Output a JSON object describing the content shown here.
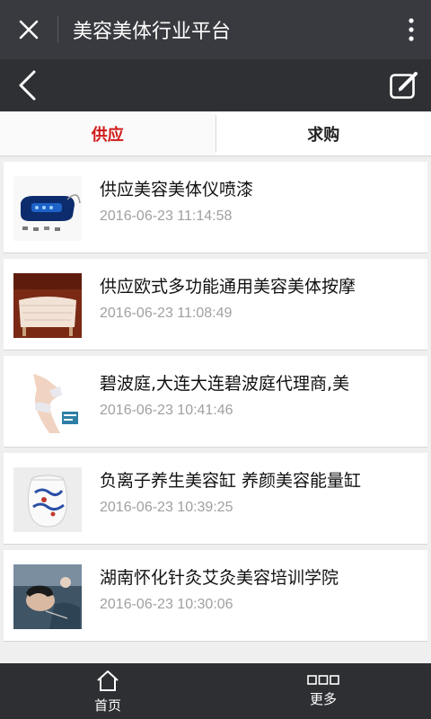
{
  "app": {
    "title": "美容美体行业平台"
  },
  "tabs": [
    {
      "label": "供应",
      "active": true
    },
    {
      "label": "求购",
      "active": false
    }
  ],
  "items": [
    {
      "title": "供应美容美体仪喷漆",
      "date": "2016-06-23 11:14:58",
      "thumb_icon": "beauty-device-image"
    },
    {
      "title": "供应欧式多功能通用美容美体按摩",
      "date": "2016-06-23 11:08:49",
      "thumb_icon": "massage-bed-image"
    },
    {
      "title": "碧波庭,大连大连碧波庭代理商,美",
      "date": "2016-06-23 10:41:46",
      "thumb_icon": "body-model-image"
    },
    {
      "title": "负离子养生美容缸 养颜美容能量缸",
      "date": "2016-06-23 10:39:25",
      "thumb_icon": "porcelain-jar-image"
    },
    {
      "title": "湖南怀化针灸艾灸美容培训学院",
      "date": "2016-06-23 10:30:06",
      "thumb_icon": "acupuncture-image"
    }
  ],
  "bottom_nav": [
    {
      "label": "首页",
      "icon": "home-icon"
    },
    {
      "label": "更多",
      "icon": "more-squares-icon"
    }
  ],
  "colors": {
    "active_tab": "#d11a1a",
    "titlebar": "#393a3f",
    "bottombar": "#2e2f33"
  }
}
